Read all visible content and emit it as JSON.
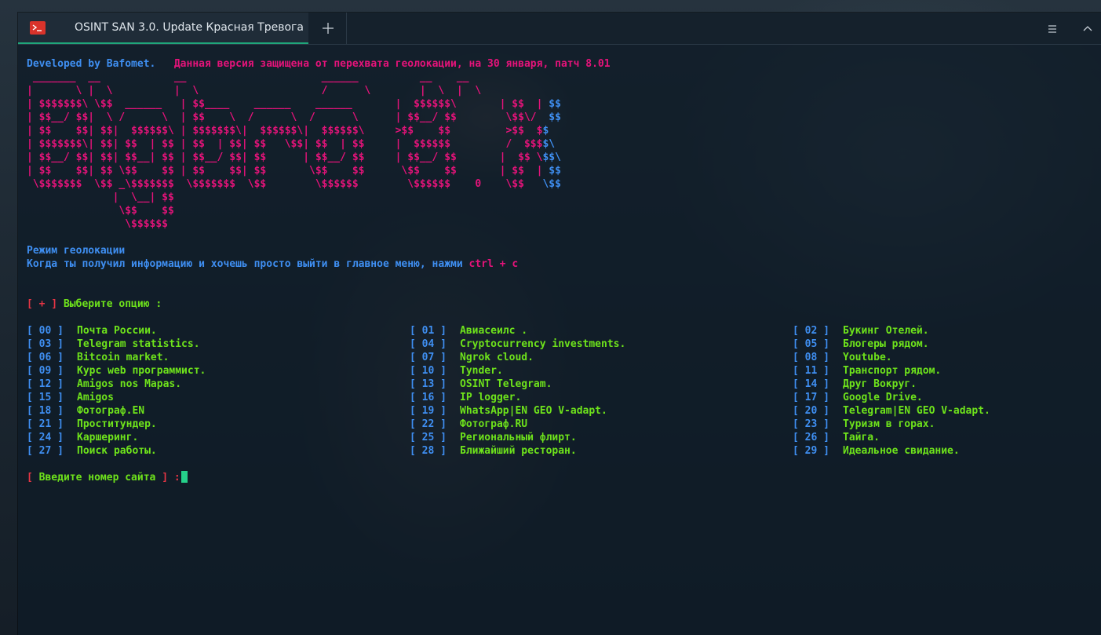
{
  "window": {
    "tab_title": "OSINT SAN 3.0. Update Красная Тревога",
    "icons": {
      "tab": "terminal-icon",
      "new_tab": "plus-icon",
      "menu": "hamburger-menu-icon",
      "close": "chevron-up-icon"
    }
  },
  "terminal": {
    "header_developer": "Developed by Bafomet.",
    "header_notice": "Данная версия защищена от перехвата геолокации, на 30 января, патч 8.01",
    "banner_lines": [
      " _______  __            __                      ______          __    __",
      "|       \\ |  \\          |  \\                    /      \\        |  \\  |  \\",
      "| $$$$$$$\\ \\$$  ______   | $$____    ______    ______       |  $$$$$$\\       | $$  | $$",
      "| $$__/ $$|  \\ /      \\  | $$    \\  /      \\  /      \\      | $$__/ $$        \\$$\\/  $$",
      "| $$    $$| $$|  $$$$$$\\ | $$$$$$$\\|  $$$$$$\\|  $$$$$$\\     >$$    $$         >$$  $$",
      "| $$$$$$$\\| $$| $$  | $$ | $$  | $$| $$   \\$$| $$  | $$     |  $$$$$$         /  $$$$\\",
      "| $$__/ $$| $$| $$__| $$ | $$__/ $$| $$      | $$__/ $$     | $$__/ $$       |  $$ \\$$\\",
      "| $$    $$| $$ \\$$    $$ | $$    $$| $$       \\$$    $$      \\$$    $$       | $$  | $$",
      " \\$$$$$$$  \\$$ _\\$$$$$$$  \\$$$$$$$  \\$$        \\$$$$$$        \\$$$$$$    0    \\$$   \\$$",
      "              |  \\__| $$",
      "               \\$$    $$",
      "                \\$$$$$$"
    ],
    "mode_title": "Режим геолокации",
    "mode_hint": "Когда ты получил информацию и хочешь просто выйти в главное меню, нажми",
    "mode_hotkey": "ctrl + c",
    "prompt_open": "[ + ]",
    "prompt_text": "Выберите опцию :",
    "options": [
      {
        "num": "[ 00 ]",
        "label": "Почта России."
      },
      {
        "num": "[ 01 ]",
        "label": "Авиасеилс ."
      },
      {
        "num": "[ 02 ]",
        "label": "Букинг Отелей."
      },
      {
        "num": "[ 03 ]",
        "label": "Telegram statistics."
      },
      {
        "num": "[ 04 ]",
        "label": "Cryptocurrency investments."
      },
      {
        "num": "[ 05 ]",
        "label": "Блогеры рядом."
      },
      {
        "num": "[ 06 ]",
        "label": "Bitcoin market."
      },
      {
        "num": "[ 07 ]",
        "label": "Ngrok cloud."
      },
      {
        "num": "[ 08 ]",
        "label": "Youtube."
      },
      {
        "num": "[ 09 ]",
        "label": "Курс web программист."
      },
      {
        "num": "[ 10 ]",
        "label": "Tynder."
      },
      {
        "num": "[ 11 ]",
        "label": "Транспорт рядом."
      },
      {
        "num": "[ 12 ]",
        "label": "Amigos nos Mapas."
      },
      {
        "num": "[ 13 ]",
        "label": "OSINT Telegram."
      },
      {
        "num": "[ 14 ]",
        "label": "Друг Вокруг."
      },
      {
        "num": "[ 15 ]",
        "label": "Amigos"
      },
      {
        "num": "[ 16 ]",
        "label": "IP logger."
      },
      {
        "num": "[ 17 ]",
        "label": "Google Drive."
      },
      {
        "num": "[ 18 ]",
        "label": "Фотограф.EN"
      },
      {
        "num": "[ 19 ]",
        "label": "WhatsApp|EN GEO V-adapt."
      },
      {
        "num": "[ 20 ]",
        "label": "Telegram|EN GEO V-adapt."
      },
      {
        "num": "[ 21 ]",
        "label": "Проститундер."
      },
      {
        "num": "[ 22 ]",
        "label": "Фотограф.RU"
      },
      {
        "num": "[ 23 ]",
        "label": "Туризм в горах."
      },
      {
        "num": "[ 24 ]",
        "label": "Каршеринг."
      },
      {
        "num": "[ 25 ]",
        "label": "Региональный флирт."
      },
      {
        "num": "[ 26 ]",
        "label": "Тайга."
      },
      {
        "num": "[ 27 ]",
        "label": "Поиск работы."
      },
      {
        "num": "[ 28 ]",
        "label": "Ближайший ресторан."
      },
      {
        "num": "[ 29 ]",
        "label": "Идеальное свидание."
      }
    ],
    "input_open": "[",
    "input_text": "Введите номер сайта",
    "input_close": "] :"
  },
  "colors": {
    "info_blue": "#3f8ff2",
    "accent_pink": "#e5137a",
    "option_green": "#6ee31b",
    "bracket_red": "#e73545",
    "cursor_green": "#25d08a",
    "tab_underline": "#1fa67a"
  }
}
